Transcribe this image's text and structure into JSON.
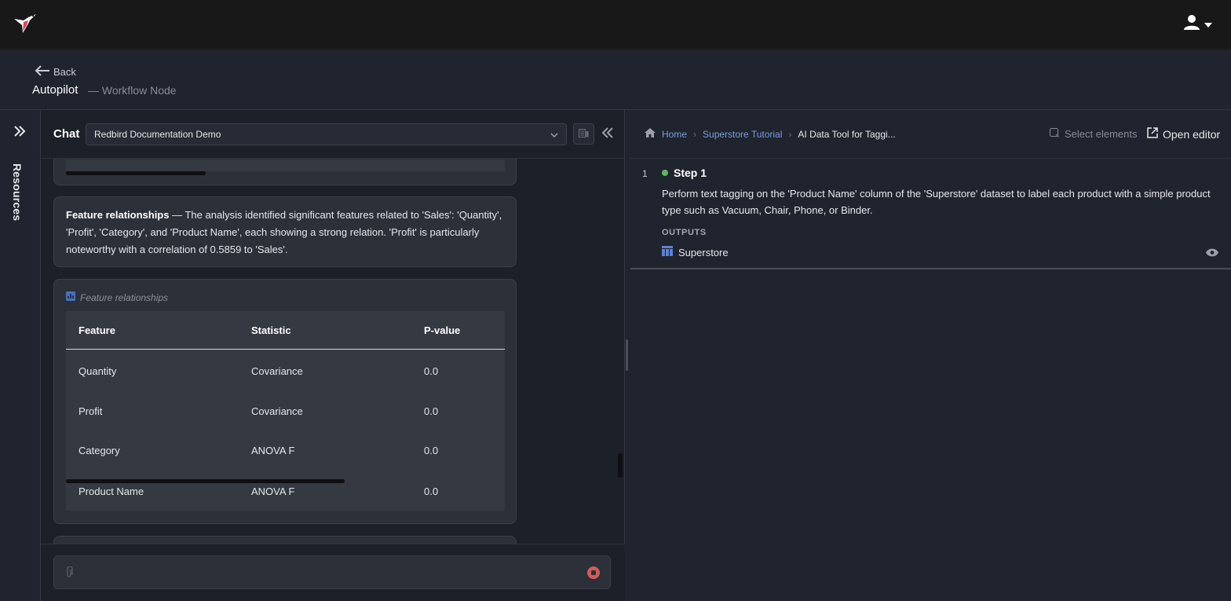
{
  "header": {
    "back_label": "Back",
    "title": "Autopilot",
    "subtitle": "— Workflow Node"
  },
  "rail": {
    "label": "Resources"
  },
  "chat": {
    "title": "Chat",
    "selected_conversation": "Redbird Documentation Demo",
    "message_text": {
      "bold": "Feature relationships",
      "body": " — The analysis identified significant features related to 'Sales': 'Quantity', 'Profit', 'Category', and 'Product Name', each showing a strong relation. 'Profit' is particularly noteworthy with a correlation of 0.5859 to 'Sales'."
    },
    "table": {
      "caption": "Feature relationships",
      "columns": [
        "Feature",
        "Statistic",
        "P-value"
      ],
      "rows": [
        [
          "Quantity",
          "Covariance",
          "0.0"
        ],
        [
          "Profit",
          "Covariance",
          "0.0"
        ],
        [
          "Category",
          "ANOVA F",
          "0.0"
        ],
        [
          "Product Name",
          "ANOVA F",
          "0.0"
        ]
      ]
    },
    "input_placeholder": ""
  },
  "workflow": {
    "breadcrumb": [
      "Home",
      "Superstore Tutorial",
      "AI Data Tool for Taggi..."
    ],
    "select_elements_label": "Select elements",
    "open_editor_label": "Open editor",
    "step": {
      "number": "1",
      "title": "Step 1",
      "description": "Perform text tagging on the 'Product Name' column of the 'Superstore' dataset to label each product with a simple product type such as Vacuum, Chair, Phone, or Binder.",
      "outputs_label": "OUTPUTS",
      "output_name": "Superstore",
      "status_color": "#5cb85c"
    }
  },
  "colors": {
    "topbar": "#181818",
    "background": "#1f242e",
    "link": "#7d9ce0",
    "stop": "#d45b5b"
  }
}
